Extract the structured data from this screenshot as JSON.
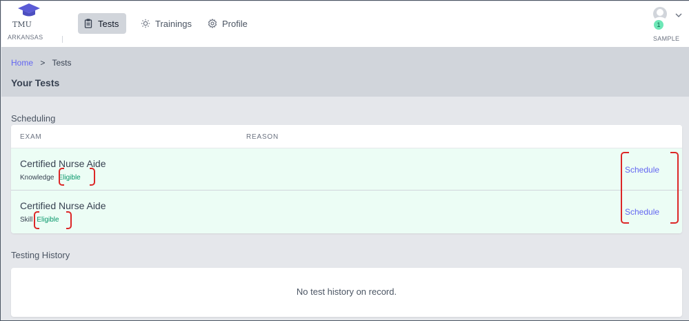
{
  "logo": {
    "abbr": "TMU",
    "state": "ARKANSAS"
  },
  "nav": {
    "items": [
      {
        "label": "Tests",
        "icon": "clipboard-icon",
        "active": true
      },
      {
        "label": "Trainings",
        "icon": "lightbulb-icon",
        "active": false
      },
      {
        "label": "Profile",
        "icon": "gear-icon",
        "active": false
      }
    ]
  },
  "user": {
    "name": "SAMPLE",
    "badge_count": "1"
  },
  "breadcrumb": {
    "home": "Home",
    "separator": ">",
    "current": "Tests"
  },
  "page": {
    "title": "Your Tests"
  },
  "scheduling": {
    "title": "Scheduling",
    "columns": [
      "EXAM",
      "REASON"
    ],
    "rows": [
      {
        "exam": "Certified Nurse Aide",
        "type": "Knowledge",
        "status": "Eligible",
        "action": "Schedule"
      },
      {
        "exam": "Certified Nurse Aide",
        "type": "Skill",
        "status": "Eligible",
        "action": "Schedule"
      }
    ]
  },
  "history": {
    "title": "Testing History",
    "empty_message": "No test history on record."
  },
  "colors": {
    "accent": "#6366f1",
    "eligible": "#059669",
    "row_background": "#ecfdf5",
    "annotation": "#dc2626"
  }
}
